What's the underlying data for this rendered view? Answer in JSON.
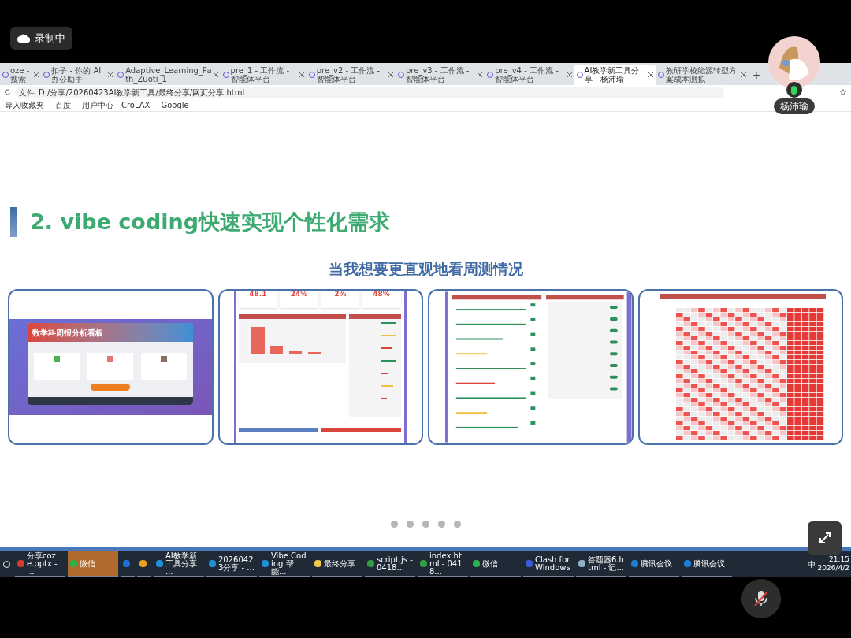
{
  "recording": {
    "label": "录制中"
  },
  "participant": {
    "name": "杨沛瑜",
    "speaking": true
  },
  "browser": {
    "tabs": [
      {
        "title": "oze - 搜索",
        "selected": false
      },
      {
        "title": "扣子 - 你的 AI 办公助手",
        "selected": false
      },
      {
        "title": "Adaptive_Learning_Path_Zuoti_1",
        "selected": false
      },
      {
        "title": "pre_1 - 工作流 - 智能体平台",
        "selected": false
      },
      {
        "title": "pre_v2 - 工作流 - 智能体平台",
        "selected": false
      },
      {
        "title": "pre_v3 - 工作流 - 智能体平台",
        "selected": false
      },
      {
        "title": "pre_v4 - 工作流 - 智能体平台",
        "selected": false
      },
      {
        "title": "AI教学新工具分享 - 杨沛瑜",
        "selected": true
      },
      {
        "title": "教研学校能源转型方案成本测拟",
        "selected": false
      }
    ],
    "new_tab": "+",
    "address": {
      "prefix": "文件",
      "url": "D:/分享/20260423AI教学新工具/最终分享/网页分享.html"
    },
    "bookmarks": [
      "导入收藏夹",
      "百度",
      "用户中心 - CroLAX",
      "Google"
    ]
  },
  "slide": {
    "heading": "2. vibe coding快速实现个性化需求",
    "subtitle": "当我想要更直观地看周测情况",
    "thumbnails": [
      {
        "kind": "dashboard",
        "title": "数学科周报分析看板"
      },
      {
        "kind": "stats",
        "stats": [
          "48.1",
          "24%",
          "2%",
          "48%"
        ]
      },
      {
        "kind": "list"
      },
      {
        "kind": "heatmap"
      }
    ],
    "pager": [
      {
        "selected": false
      },
      {
        "selected": false
      },
      {
        "selected": false
      },
      {
        "selected": false
      },
      {
        "selected": false
      }
    ]
  },
  "taskbar": {
    "items": [
      {
        "kind": "app",
        "label": "分享coze.pptx - ...",
        "highlighted": false,
        "color": "#d33b2c"
      },
      {
        "kind": "app",
        "label": "微信",
        "highlighted": true,
        "color": "#2bb24c"
      },
      {
        "kind": "pinned",
        "highlighted": false,
        "color": "#1e6fd9"
      },
      {
        "kind": "pinned",
        "highlighted": false,
        "color": "#e8a317"
      },
      {
        "kind": "app",
        "label": "AI教学新工具分享 ...",
        "highlighted": false,
        "color": "#1e90d6"
      },
      {
        "kind": "app",
        "label": "20260423分享 - ...",
        "highlighted": false,
        "color": "#1e90d6"
      },
      {
        "kind": "app",
        "label": "Vibe Coding 帮能...",
        "highlighted": false,
        "color": "#1e90d6"
      },
      {
        "kind": "app",
        "label": "最终分享",
        "highlighted": false,
        "color": "#f2c94c"
      },
      {
        "kind": "app",
        "label": "script.js - 0418...",
        "highlighted": false,
        "color": "#2f9e44"
      },
      {
        "kind": "app",
        "label": "index.html - 0418...",
        "highlighted": false,
        "color": "#2f9e44"
      },
      {
        "kind": "app",
        "label": "微信",
        "highlighted": false,
        "color": "#2bb24c"
      },
      {
        "kind": "app",
        "label": "Clash for Windows",
        "highlighted": false,
        "color": "#3b5bdb"
      },
      {
        "kind": "app",
        "label": "答题器6.html - 记...",
        "highlighted": false,
        "color": "#8fb3c9"
      },
      {
        "kind": "app",
        "label": "腾讯会议",
        "highlighted": false,
        "color": "#1c7ed6"
      },
      {
        "kind": "app",
        "label": "腾讯会议",
        "highlighted": false,
        "color": "#1c7ed6"
      }
    ],
    "ime": "中",
    "time": "21:15",
    "date": "2026/4/2"
  }
}
